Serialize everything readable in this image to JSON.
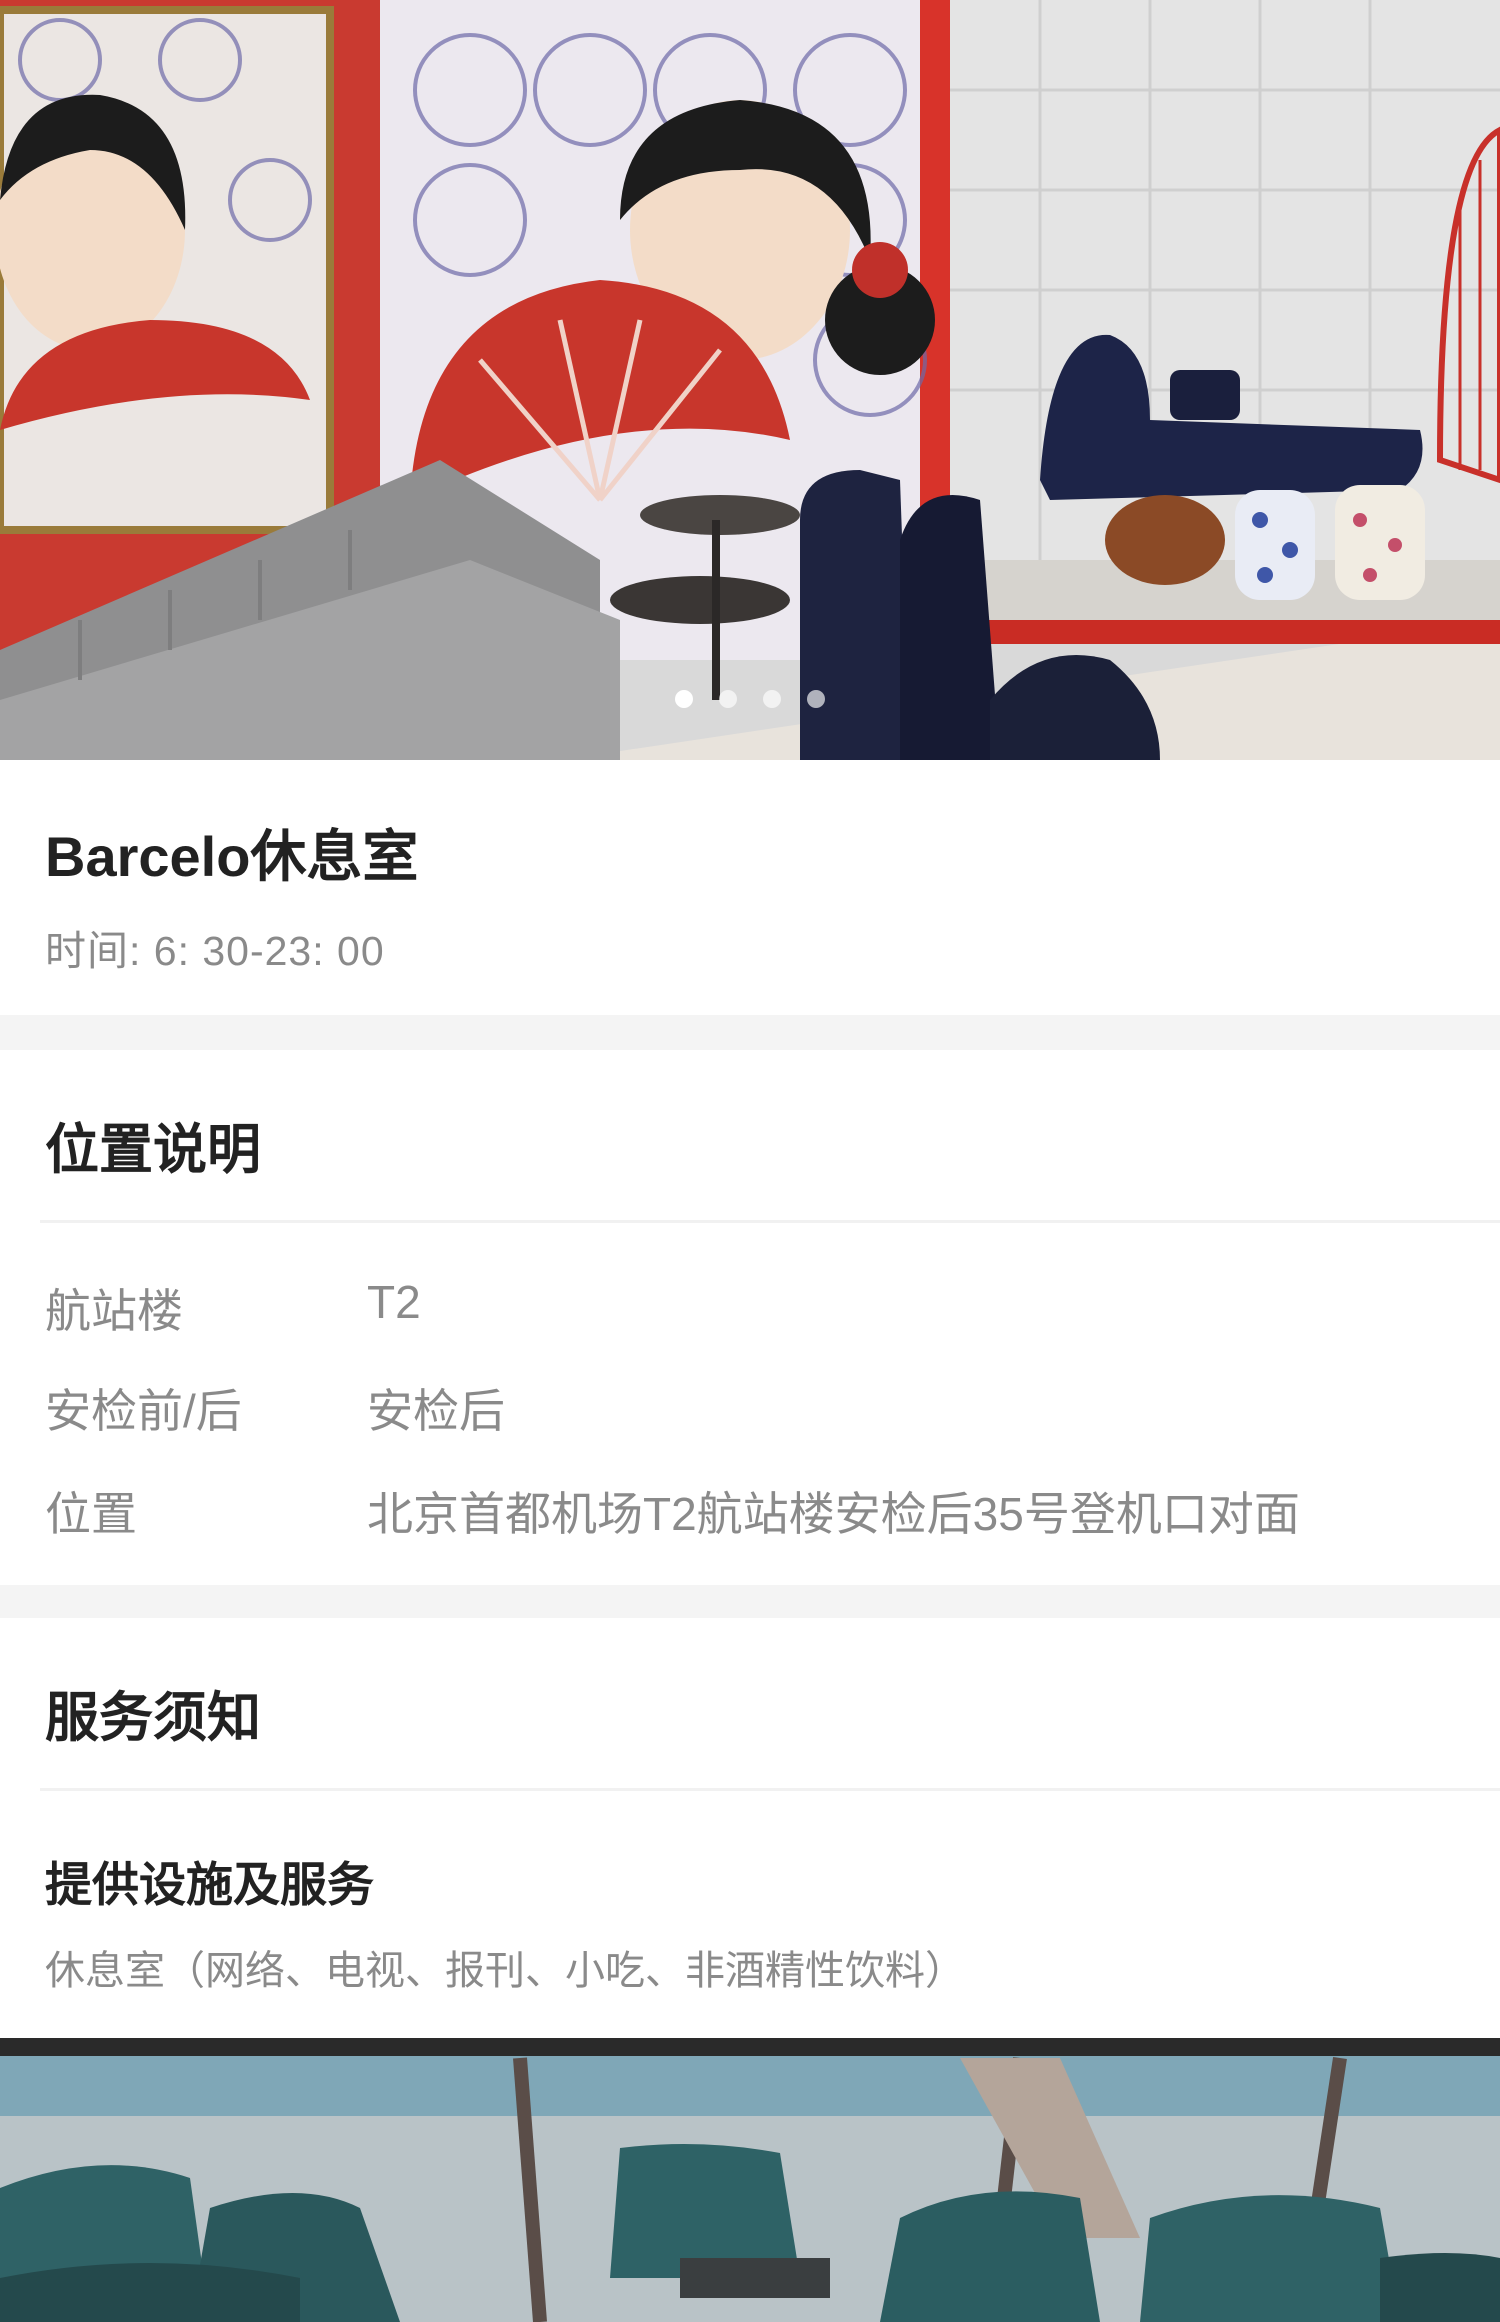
{
  "carousel": {
    "image_desc_icon": "lounge-photo",
    "slide_count": 4,
    "active_slide": 1
  },
  "lounge": {
    "name": "Barcelo休息室",
    "hours": "时间: 6: 30-23: 00"
  },
  "location": {
    "heading": "位置说明",
    "rows": [
      {
        "label": "航站楼",
        "value": "T2"
      },
      {
        "label": "安检前/后",
        "value": "安检后"
      },
      {
        "label": "位置",
        "value": "北京首都机场T2航站楼安检后35号登机口对面"
      }
    ]
  },
  "service": {
    "heading": "服务须知",
    "facilities_title": "提供设施及服务",
    "facilities_text": "休息室（网络、电视、报刊、小吃、非酒精性饮料）"
  },
  "colors": {
    "accent_red": "#d8332a",
    "text_dark": "#222222",
    "text_gray": "#8a8a8a"
  }
}
